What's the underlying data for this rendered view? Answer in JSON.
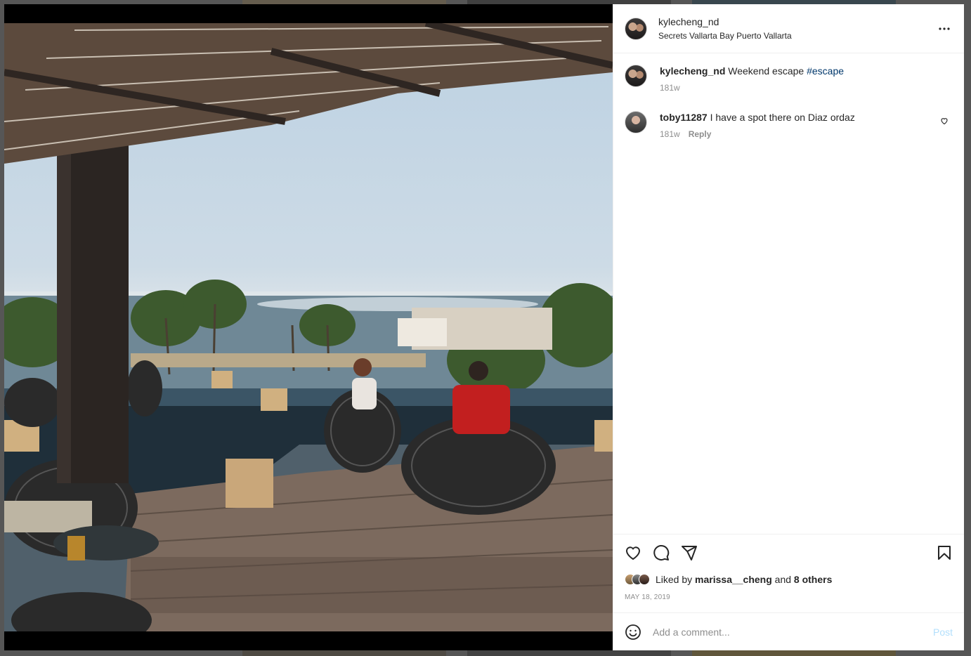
{
  "post": {
    "author": "kylecheng_nd",
    "location": "Secrets Vallarta Bay Puerto Vallarta",
    "more_icon": "more-horizontal-icon"
  },
  "caption": {
    "username": "kylecheng_nd",
    "text": "Weekend escape",
    "hashtag": "#escape",
    "time": "181w"
  },
  "comments": [
    {
      "username": "toby11287",
      "text": "I have a spot there on Diaz ordaz",
      "time": "181w",
      "reply_label": "Reply"
    }
  ],
  "actions": {
    "like_icon": "heart-icon",
    "comment_icon": "comment-icon",
    "share_icon": "share-icon",
    "save_icon": "bookmark-icon"
  },
  "likes": {
    "prefix": "Liked by",
    "user": "marissa__cheng",
    "conj": "and",
    "others": "8 others"
  },
  "date": "MAY 18, 2019",
  "composer": {
    "placeholder": "Add a comment...",
    "post_label": "Post"
  },
  "colors": {
    "link": "#00376b",
    "post_disabled": "#b2dffc",
    "secondary_text": "#8e8e8e"
  }
}
